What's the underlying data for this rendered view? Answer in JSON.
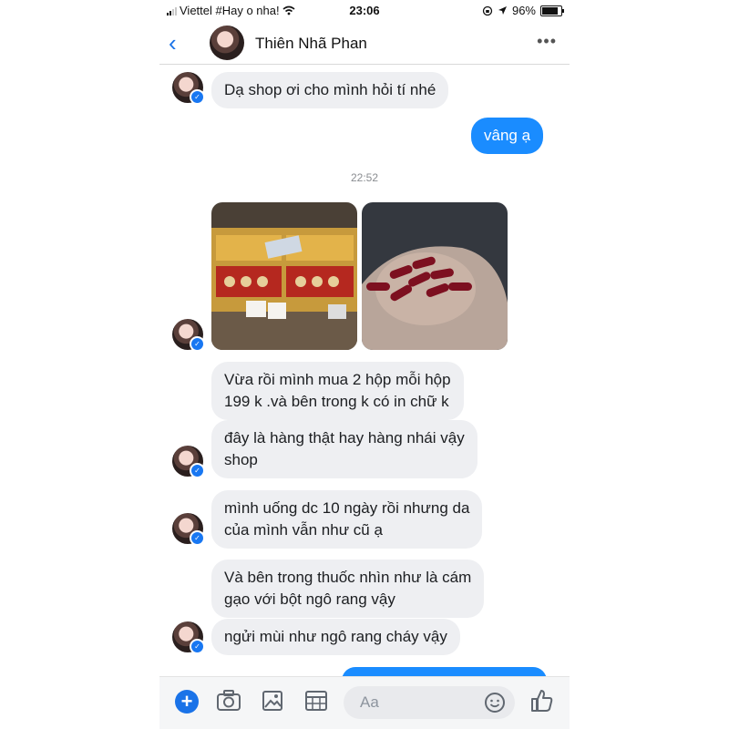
{
  "status_bar": {
    "carrier": "Viettel #Hay o nha!",
    "time": "23:06",
    "battery": "96%"
  },
  "header": {
    "contact_name": "Thiên Nhã Phan"
  },
  "conversation": {
    "timestamp": "22:52",
    "messages": [
      {
        "from": "contact",
        "text": "Dạ shop ơi cho mình hỏi tí nhé"
      },
      {
        "from": "me",
        "text": "vâng ạ"
      },
      {
        "from": "contact",
        "line1": "Vừa rồi mình mua 2 hộp mỗi hộp",
        "line2": "199 k .và bên trong k có in chữ k"
      },
      {
        "from": "contact",
        "line1": "đây là hàng thật hay hàng nhái vậy",
        "line2": "shop"
      },
      {
        "from": "contact",
        "line1": "mình uống dc 10 ngày rồi nhưng da",
        "line2": "của mình vẫn như cũ ạ"
      },
      {
        "from": "contact",
        "line1": "Và bên trong thuốc nhìn như là cám",
        "line2": "gạo với bột ngô rang vậy"
      },
      {
        "from": "contact",
        "text": "ngửi mùi như ngô rang cháy vậy"
      }
    ]
  },
  "composer": {
    "placeholder": "Aa"
  },
  "colors": {
    "accent": "#1a73e8",
    "outgoing_bubble": "#1a8cff",
    "incoming_bubble": "#eeeff2"
  }
}
